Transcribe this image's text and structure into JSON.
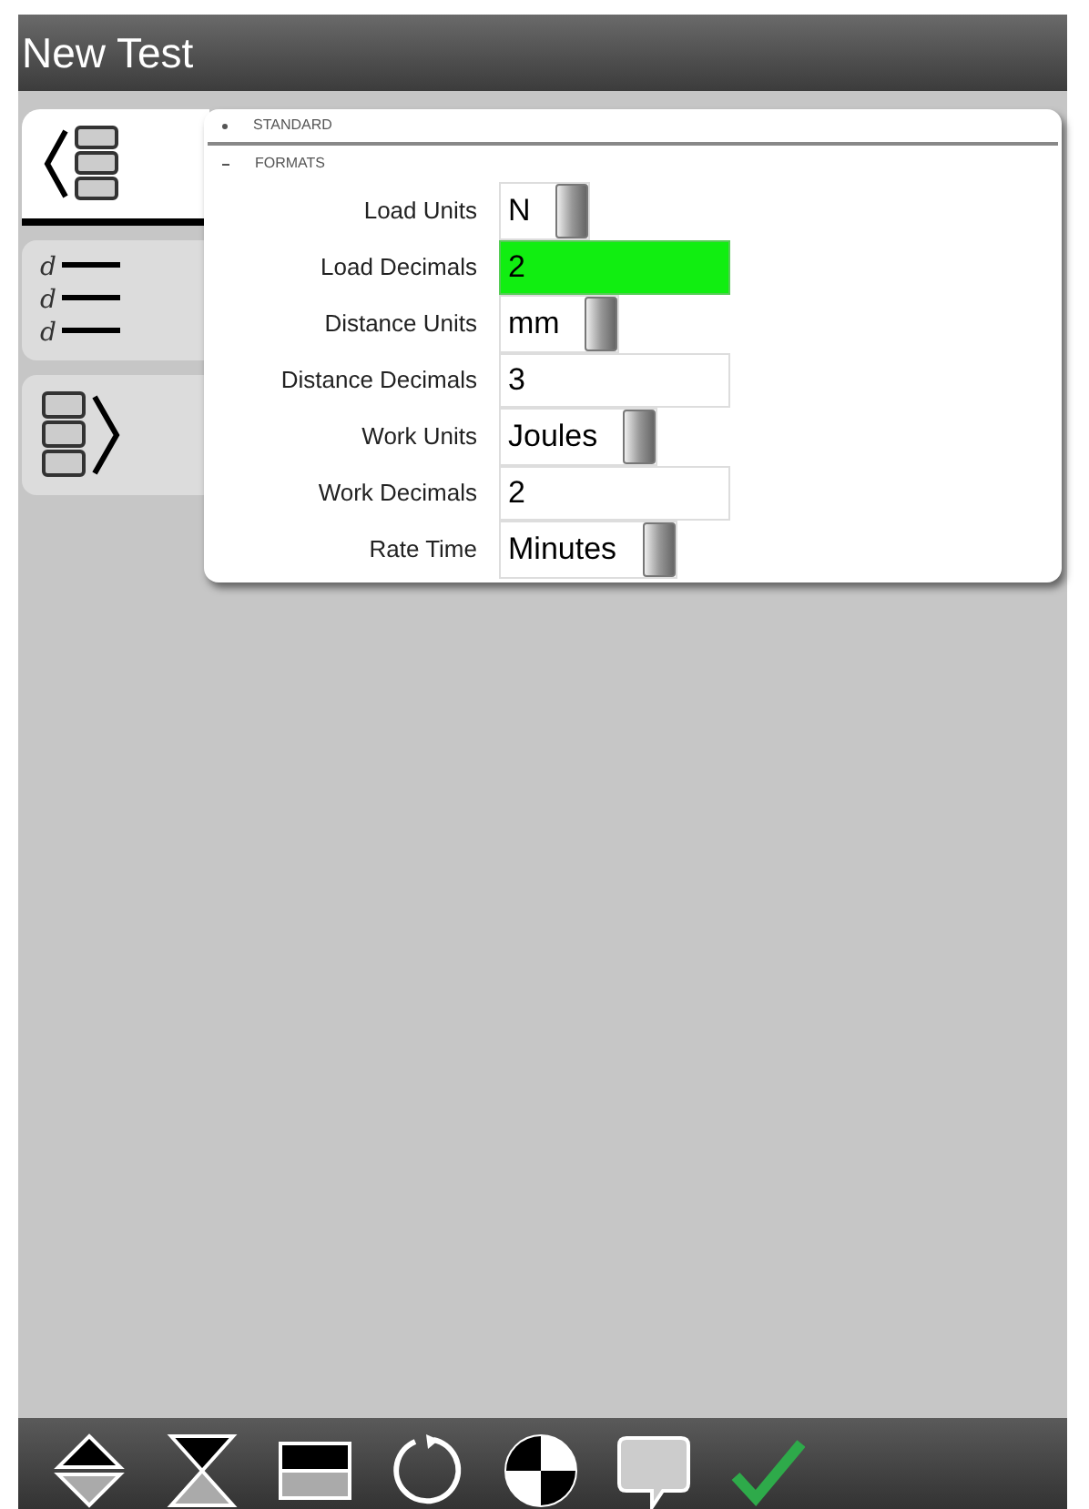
{
  "window": {
    "title": "New Test"
  },
  "side_tabs": [
    {
      "selected": true
    },
    {
      "selected": false,
      "letters": [
        "d",
        "d",
        "d"
      ]
    },
    {
      "selected": false
    }
  ],
  "sections": [
    {
      "label": "STANDARD",
      "expanded": false
    },
    {
      "label": "FORMATS",
      "expanded": true
    }
  ],
  "fields": [
    {
      "label": "Load Units",
      "kind": "select",
      "value": "N",
      "focused": false
    },
    {
      "label": "Load Decimals",
      "kind": "input",
      "value": "2",
      "focused": true
    },
    {
      "label": "Distance Units",
      "kind": "select",
      "value": "mm",
      "focused": false
    },
    {
      "label": "Distance Decimals",
      "kind": "input",
      "value": "3",
      "focused": false
    },
    {
      "label": "Work Units",
      "kind": "select",
      "value": "Joules",
      "focused": false
    },
    {
      "label": "Work Decimals",
      "kind": "input",
      "value": "2",
      "focused": false
    },
    {
      "label": "Rate Time",
      "kind": "select",
      "value": "Minutes",
      "focused": false
    }
  ]
}
